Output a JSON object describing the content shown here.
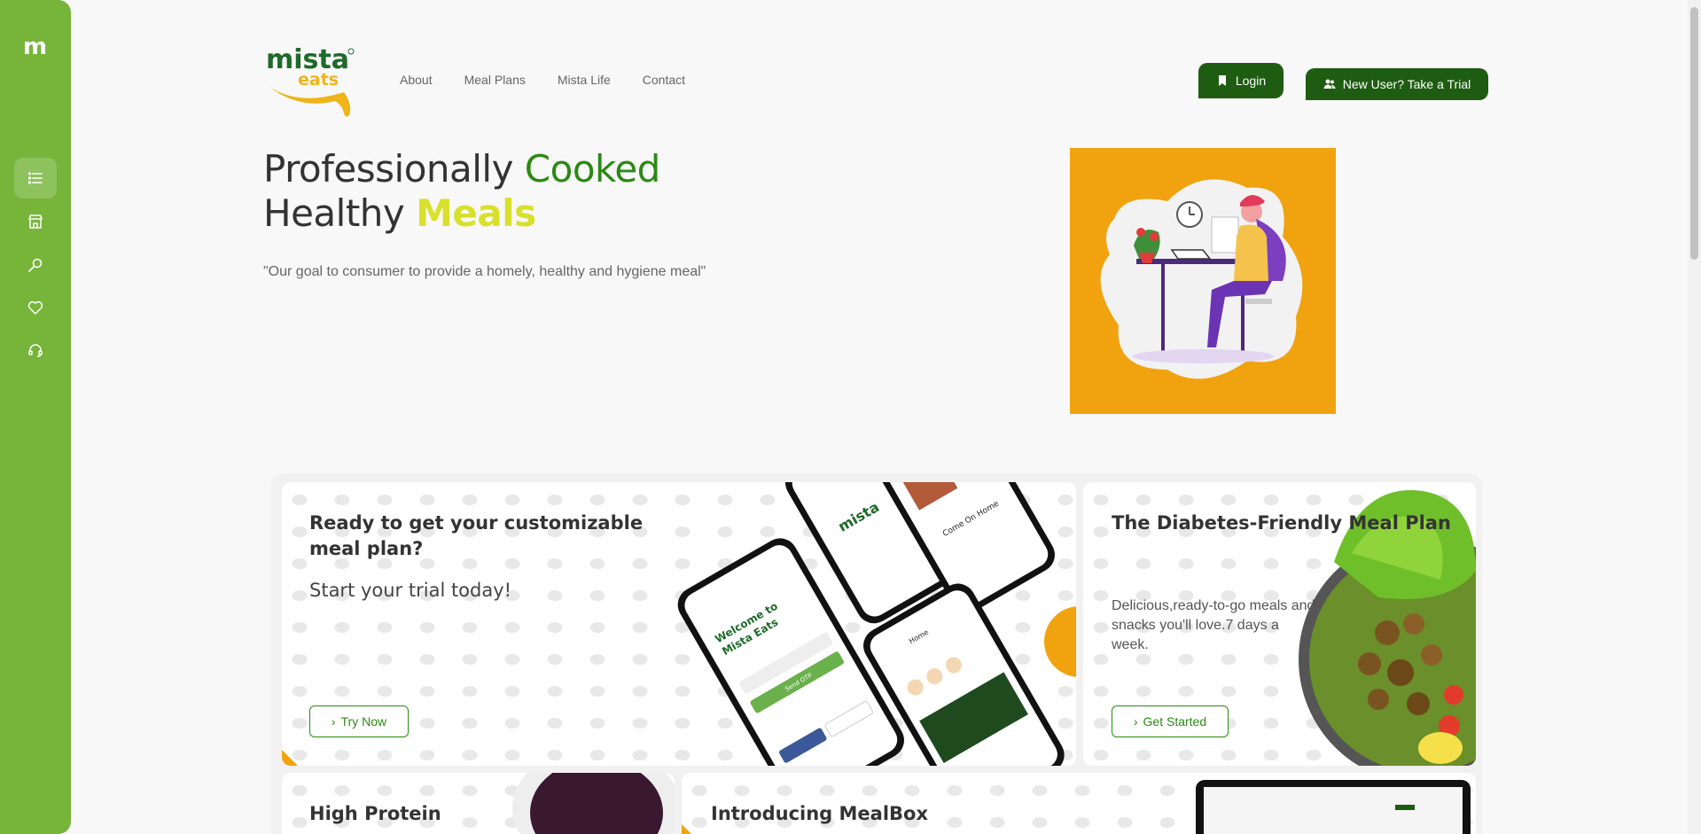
{
  "sidebar": {
    "logo": "m",
    "items": [
      {
        "icon": "list-icon"
      },
      {
        "icon": "store-icon"
      },
      {
        "icon": "search-key-icon"
      },
      {
        "icon": "heart-icon"
      },
      {
        "icon": "headset-icon"
      }
    ]
  },
  "brand": {
    "line1": "mista",
    "line2": "eats"
  },
  "nav": {
    "about": "About",
    "meal_plans": "Meal Plans",
    "mista_life": "Mista Life",
    "contact": "Contact"
  },
  "header": {
    "login": "Login",
    "trial": "New User? Take a Trial"
  },
  "hero": {
    "title_part1": "Professionally ",
    "title_part2": "Cooked",
    "title_part3": "Healthy ",
    "title_part4": "Meals",
    "quote": "\"Our goal to consumer to provide a homely, healthy and hygiene meal\""
  },
  "cards": {
    "card1": {
      "title": "Ready to get your customizable meal plan?",
      "subtitle": "Start your trial today!",
      "button": "Try Now"
    },
    "card2": {
      "title": "The Diabetes-Friendly Meal Plan",
      "text": "Delicious,ready-to-go meals and snacks you'll love.7 days a week.",
      "button": "Get Started"
    },
    "card3": {
      "title": "High Protein"
    },
    "card4": {
      "title": "Introducing MealBox"
    }
  },
  "phone": {
    "welcome": "Welcome to",
    "brand": "Mista Eats",
    "send": "Send OTP",
    "home": "Home",
    "come": "Come On Home"
  },
  "colors": {
    "sidebar": "#76b53a",
    "dark_green": "#1e5c12",
    "accent_green": "#2a8a12",
    "yellow": "#d9e02c",
    "orange": "#f0a30f"
  }
}
